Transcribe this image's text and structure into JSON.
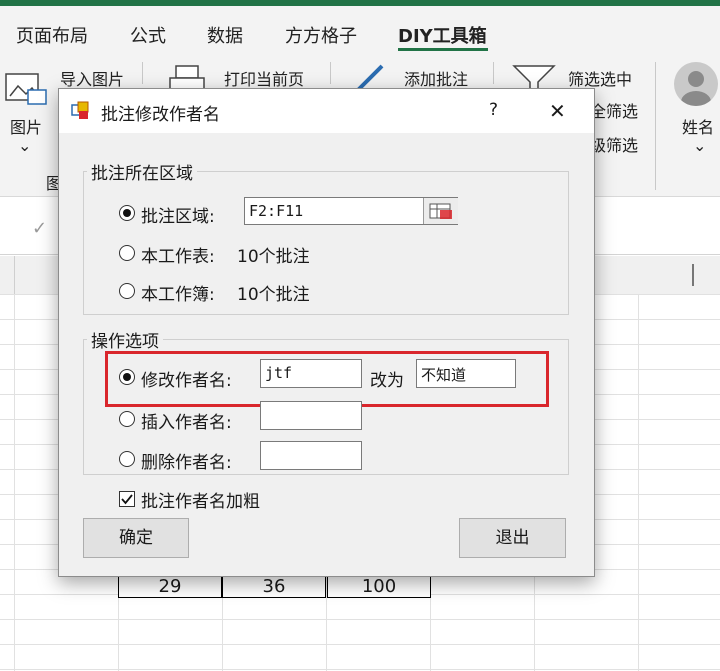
{
  "ribbon": {
    "tabs": [
      {
        "label": "页面布局"
      },
      {
        "label": "公式"
      },
      {
        "label": "数据"
      },
      {
        "label": "方方格子"
      },
      {
        "label": "DIY工具箱"
      }
    ],
    "groups": {
      "picture_label": "图片",
      "import_picture": "导入图片",
      "print_current_page": "打印当前页",
      "add_comment": "添加批注",
      "filter_selected": "筛选选中",
      "full_filter": "全筛选",
      "advanced_filter": "级筛选",
      "name_label": "姓名",
      "group_fragment": "图"
    }
  },
  "sheet": {
    "visible_row": [
      "29",
      "36",
      "100"
    ]
  },
  "dialog": {
    "title": "批注修改作者名",
    "help": "?",
    "close": "✕",
    "area_group": {
      "label": "批注所在区域",
      "option_area": "批注区域:",
      "area_value": "F2:F11",
      "option_sheet": "本工作表:",
      "sheet_count": "10个批注",
      "option_workbook": "本工作簿:",
      "workbook_count": "10个批注"
    },
    "ops_group": {
      "label": "操作选项",
      "modify_author": "修改作者名:",
      "old_author": "jtf",
      "change_to": "改为",
      "new_author": "不知道",
      "insert_author": "插入作者名:",
      "delete_author": "删除作者名:"
    },
    "bold_author": "批注作者名加粗",
    "ok": "确定",
    "exit": "退出"
  }
}
